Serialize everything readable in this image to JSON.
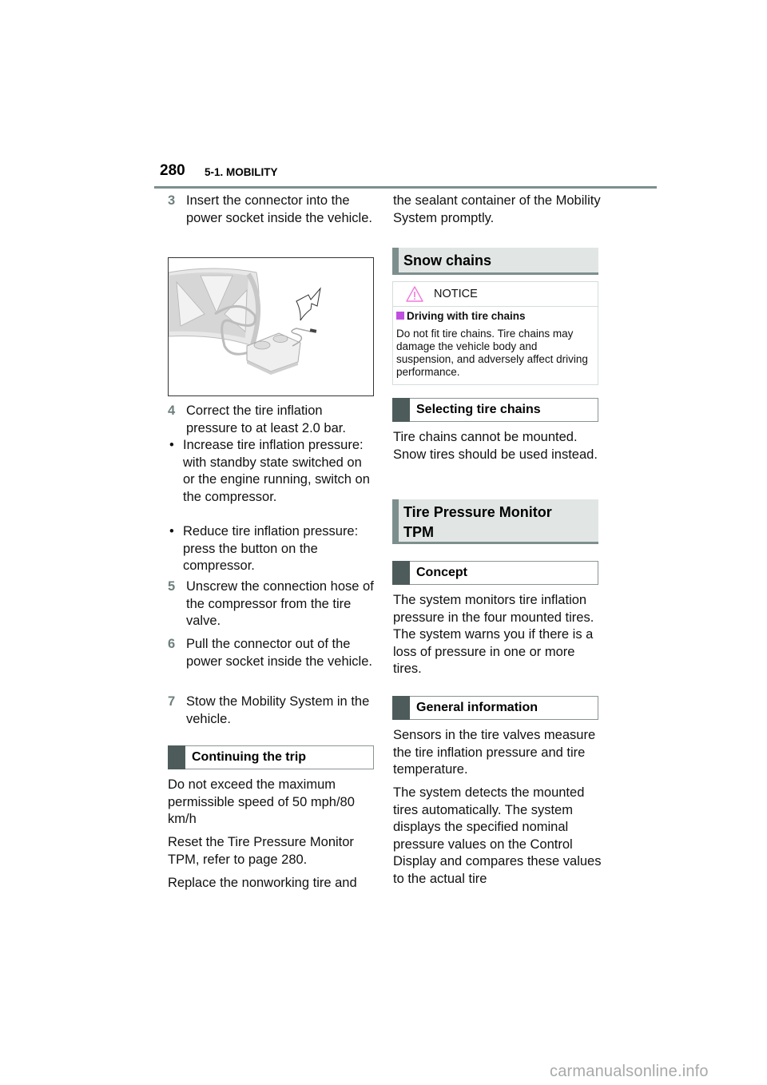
{
  "header": {
    "page_number": "280",
    "section": "5-1. MOBILITY"
  },
  "left_column": {
    "step3": {
      "num": "3",
      "text": "Insert the connector into the power socket inside the vehicle."
    },
    "figure": {
      "alt": "Compressor connected to wheel valve with arrow pointing to power connector plug"
    },
    "step4": {
      "num": "4",
      "text": "Correct the tire inflation pressure to at least 2.0 bar."
    },
    "bullets": [
      {
        "symbol": "•",
        "text": "Increase tire inflation pressure: with standby state switched on or the engine running, switch on the compressor."
      },
      {
        "symbol": "•",
        "text": "Reduce tire inflation pressure: press the button on the compressor."
      }
    ],
    "step5": {
      "num": "5",
      "text": "Unscrew the connection hose of the compressor from the tire valve."
    },
    "step6": {
      "num": "6",
      "text": "Pull the connector out of the power socket inside the vehicle."
    },
    "step7": {
      "num": "7",
      "text": "Stow the Mobility System in the vehicle."
    },
    "continuing_heading": "Continuing the trip",
    "para1": "Do not exceed the maximum permissible speed of 50 mph/80 km/h",
    "para2": "Reset the Tire Pressure Monitor TPM, refer to page 280.",
    "para3": "Replace the nonworking tire and"
  },
  "right_column": {
    "cont_para": "the sealant container of the Mobility System promptly.",
    "snow_chains_heading": "Snow chains",
    "notice": {
      "label": "NOTICE",
      "icon": "warning-triangle-icon",
      "subheading": "Driving with tire chains",
      "message": "Do not fit tire chains. Tire chains may damage the vehicle body and suspension, and adversely affect driving performance.",
      "accent_color": "#c04fe0",
      "icon_color": "#f07ad8"
    },
    "selecting_heading": "Selecting tire chains",
    "selecting_para": "Tire chains cannot be mounted. Snow tires should be used instead.",
    "tpm_heading": "Tire Pressure Monitor TPM",
    "concept_heading": "Concept",
    "concept_para": "The system monitors tire inflation pressure in the four mounted tires. The system warns you if there is a loss of pressure in one or more tires.",
    "general_heading": "General information",
    "general_para1": "Sensors in the tire valves measure the tire inflation pressure and tire temperature.",
    "general_para2": "The system detects the mounted tires automatically. The system displays the specified nominal pressure values on the Control Display and compares these values to the actual tire"
  },
  "watermark": "carmanualsonline.info"
}
